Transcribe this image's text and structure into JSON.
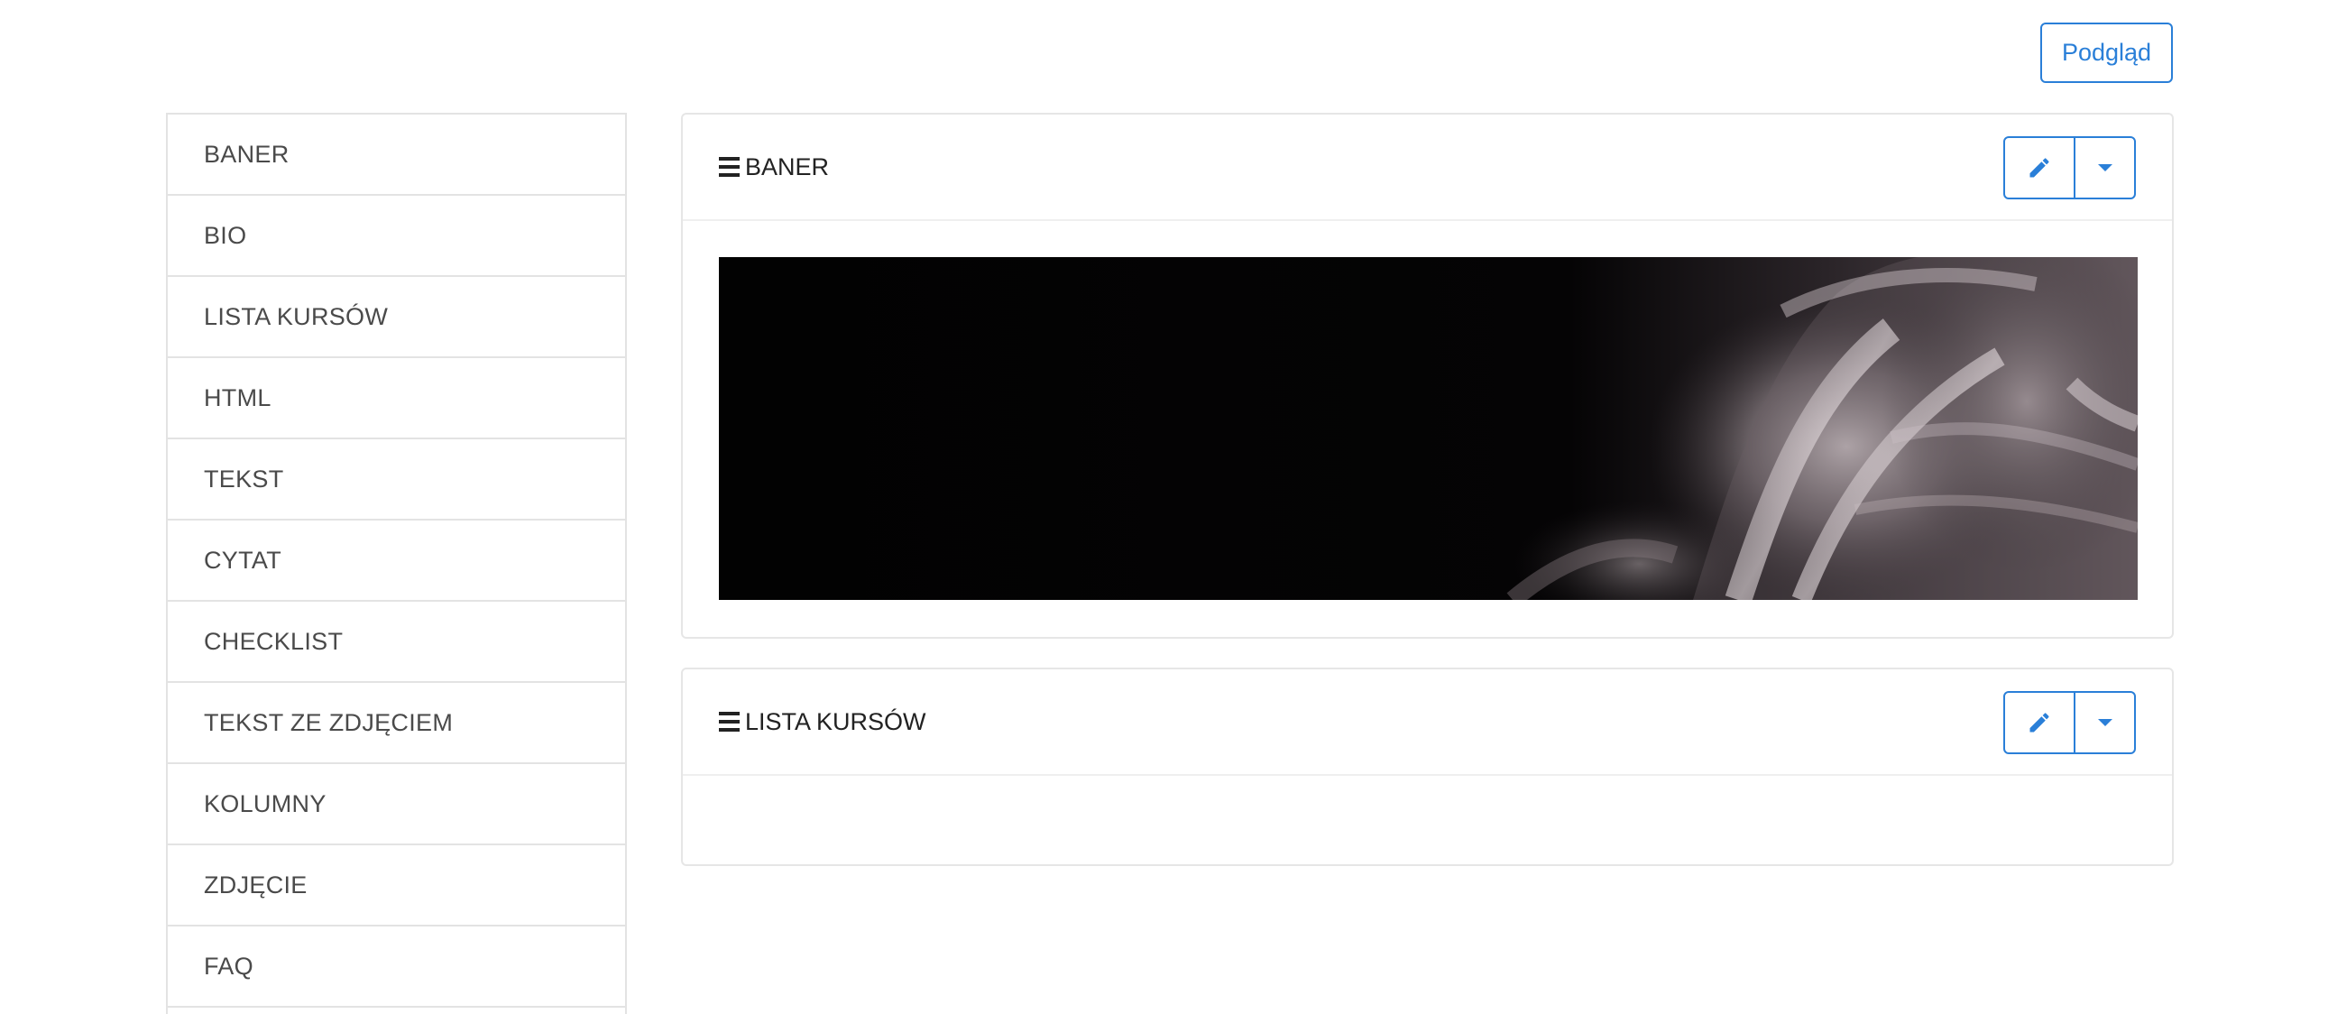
{
  "header": {
    "preview_label": "Podgląd"
  },
  "sidebar": {
    "items": [
      {
        "label": "BANER"
      },
      {
        "label": "BIO"
      },
      {
        "label": "LISTA KURSÓW"
      },
      {
        "label": "HTML"
      },
      {
        "label": "TEKST"
      },
      {
        "label": "CYTAT"
      },
      {
        "label": "CHECKLIST"
      },
      {
        "label": "TEKST ZE ZDJĘCIEM"
      },
      {
        "label": "KOLUMNY"
      },
      {
        "label": "ZDJĘCIE"
      },
      {
        "label": "FAQ"
      }
    ]
  },
  "sections": [
    {
      "title": "BANER",
      "edit_icon": "pencil-icon",
      "menu_icon": "caret-down-icon",
      "has_image": true
    },
    {
      "title": "LISTA KURSÓW",
      "edit_icon": "pencil-icon",
      "menu_icon": "caret-down-icon"
    }
  ],
  "colors": {
    "accent": "#2a7fd8",
    "border": "#e3e3e3",
    "text": "#4a4a4a"
  }
}
